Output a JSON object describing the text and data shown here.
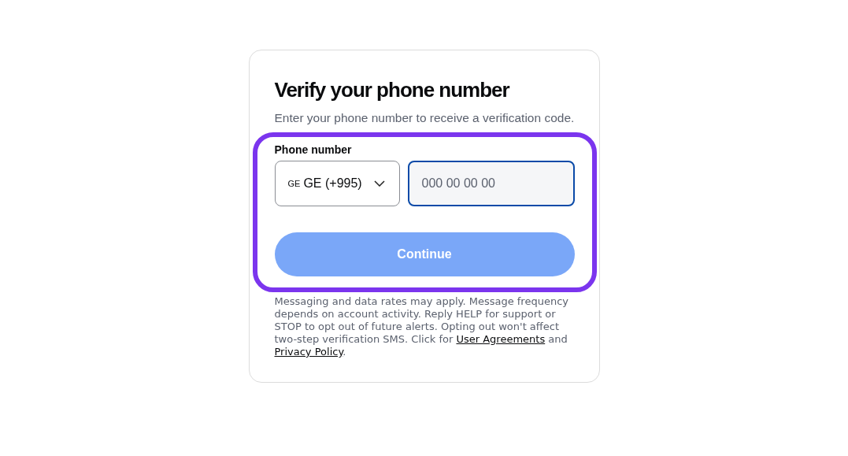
{
  "title": "Verify your phone number",
  "subtitle": "Enter your phone number to receive a verification code.",
  "phone": {
    "label": "Phone number",
    "country_flag": "GE",
    "country": "GE (+995)",
    "placeholder": "000 00 00 00",
    "focused": true
  },
  "continue_button": {
    "label": "Continue",
    "disabled": true
  },
  "highlight": {
    "shown": true
  },
  "disclaimer": [
    {
      "kind": "text",
      "text": "Messaging and data rates may apply. Message frequency depends on account activity. Reply HELP for support or STOP to opt out of future alerts. Opting out won't affect two-step verification SMS. Click for "
    },
    {
      "kind": "link",
      "text": "User Agreements"
    },
    {
      "kind": "text",
      "text": " and "
    },
    {
      "kind": "link",
      "text": "Privacy Policy"
    },
    {
      "kind": "text",
      "text": "."
    }
  ]
}
